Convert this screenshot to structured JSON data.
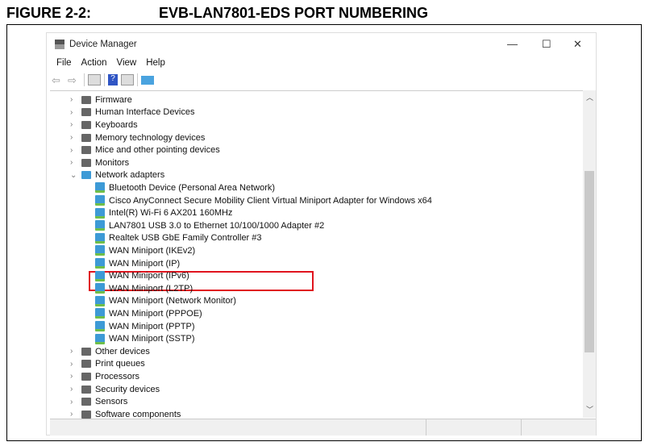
{
  "figure": {
    "label": "FIGURE 2-2:",
    "title": "EVB-LAN7801-EDS PORT NUMBERING"
  },
  "window": {
    "title": "Device Manager",
    "minimize": "—",
    "maximize": "☐",
    "close": "✕"
  },
  "menu": [
    "File",
    "Action",
    "View",
    "Help"
  ],
  "toolbar": [
    "back-icon",
    "forward-icon",
    "properties-icon",
    "help-icon",
    "update-driver-icon",
    "monitor-icon"
  ],
  "tree": [
    {
      "label": "Firmware",
      "level": 0,
      "expanded": false
    },
    {
      "label": "Human Interface Devices",
      "level": 0,
      "expanded": false
    },
    {
      "label": "Keyboards",
      "level": 0,
      "expanded": false
    },
    {
      "label": "Memory technology devices",
      "level": 0,
      "expanded": false
    },
    {
      "label": "Mice and other pointing devices",
      "level": 0,
      "expanded": false
    },
    {
      "label": "Monitors",
      "level": 0,
      "expanded": false
    },
    {
      "label": "Network adapters",
      "level": 0,
      "expanded": true
    },
    {
      "label": "Bluetooth Device (Personal Area Network)",
      "level": 1
    },
    {
      "label": "Cisco AnyConnect Secure Mobility Client Virtual Miniport Adapter for Windows x64",
      "level": 1
    },
    {
      "label": "Intel(R) Wi-Fi 6 AX201 160MHz",
      "level": 1
    },
    {
      "label": "LAN7801 USB 3.0 to Ethernet 10/100/1000 Adapter #2",
      "level": 1,
      "highlighted": true
    },
    {
      "label": "Realtek USB GbE Family Controller #3",
      "level": 1
    },
    {
      "label": "WAN Miniport (IKEv2)",
      "level": 1
    },
    {
      "label": "WAN Miniport (IP)",
      "level": 1
    },
    {
      "label": "WAN Miniport (IPv6)",
      "level": 1
    },
    {
      "label": "WAN Miniport (L2TP)",
      "level": 1
    },
    {
      "label": "WAN Miniport (Network Monitor)",
      "level": 1
    },
    {
      "label": "WAN Miniport (PPPOE)",
      "level": 1
    },
    {
      "label": "WAN Miniport (PPTP)",
      "level": 1
    },
    {
      "label": "WAN Miniport (SSTP)",
      "level": 1
    },
    {
      "label": "Other devices",
      "level": 0,
      "expanded": false
    },
    {
      "label": "Print queues",
      "level": 0,
      "expanded": false
    },
    {
      "label": "Processors",
      "level": 0,
      "expanded": false
    },
    {
      "label": "Security devices",
      "level": 0,
      "expanded": false
    },
    {
      "label": "Sensors",
      "level": 0,
      "expanded": false
    },
    {
      "label": "Software components",
      "level": 0,
      "expanded": false
    }
  ],
  "colors": {
    "highlight": "#e0141e",
    "network": "#3d9ad6"
  }
}
